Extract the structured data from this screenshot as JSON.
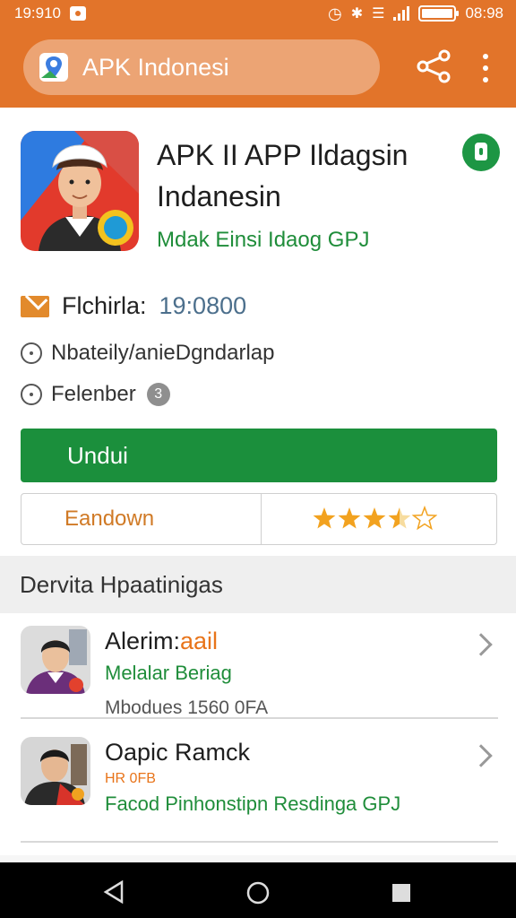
{
  "status_bar": {
    "time": "19:910",
    "right_time": "08:98"
  },
  "toolbar": {
    "search_text": "APK Indonesi"
  },
  "app": {
    "title": "APK II APP Ildagsin Indanesin",
    "developer": "Mdak Einsi Idaog GPJ"
  },
  "meta": {
    "label": "Flchirla:",
    "value": "19:0800",
    "line2": "Nbateily/anieDgndarlap",
    "line3": "Felenber",
    "line3_badge": "3"
  },
  "buttons": {
    "install": "Undui",
    "secondary": "Eandown"
  },
  "rating": {
    "stars": 3.5,
    "max": 5
  },
  "section": {
    "title": "Dervita Hpaatinigas"
  },
  "items": [
    {
      "title_main": "Alerim:",
      "title_accent": "aail",
      "subtitle": "Melalar Beriag",
      "meta": "Mbodues 1560 0FA"
    },
    {
      "title_main": "Oapic Ramck",
      "tag": "HR 0FB",
      "subtitle": "Facod Pinhonstipn Resdinga GPJ"
    }
  ],
  "colors": {
    "primary": "#e2742a",
    "green": "#1b8f3c",
    "star": "#f2a21f"
  }
}
